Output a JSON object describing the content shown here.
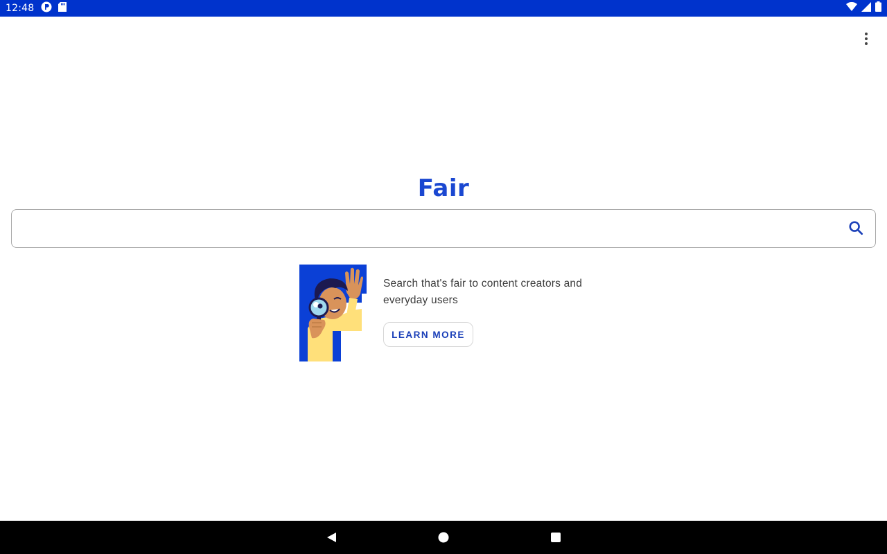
{
  "status_bar": {
    "time": "12:48",
    "left_icons": [
      "app-notification-icon",
      "sd-card-icon"
    ],
    "right_icons": [
      "wifi-icon",
      "signal-icon",
      "battery-icon"
    ],
    "background": "#0033cc"
  },
  "header": {
    "overflow_icon": "more-vert-icon"
  },
  "brand": {
    "title": "Fair",
    "color": "#1a47d1"
  },
  "search": {
    "value": "",
    "placeholder": "",
    "icon": "search-icon"
  },
  "promo": {
    "text": "Search that's fair to content creators and everyday users",
    "button_label": "LEARN MORE",
    "accent_color": "#0b40d6",
    "highlight_color": "#ffe07a"
  },
  "nav_bar": {
    "buttons": [
      "back-icon",
      "home-icon",
      "recents-icon"
    ]
  }
}
